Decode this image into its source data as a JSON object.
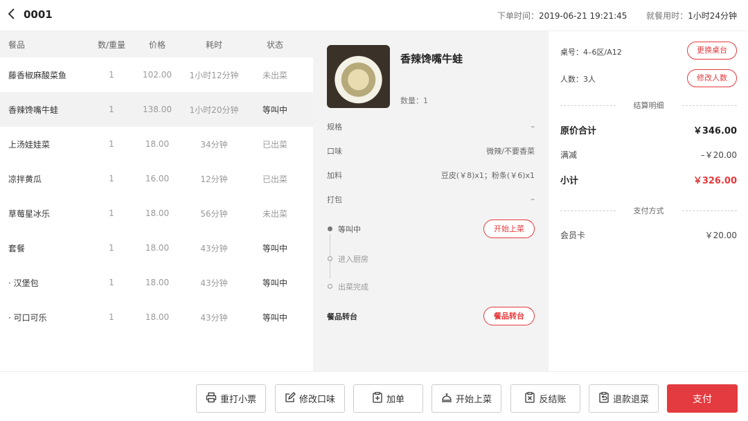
{
  "header": {
    "back_icon": "chevron-left-icon",
    "order_no": "0001",
    "order_time_label": "下单时间：",
    "order_time": "2019-06-21 19:21:45",
    "dining_time_label": "就餐用时：",
    "dining_time": "1小时24分钟"
  },
  "table": {
    "headers": [
      "餐品",
      "数/重量",
      "价格",
      "耗时",
      "状态"
    ],
    "rows": [
      {
        "name": "藤香椒麻酸菜鱼",
        "qty": "1",
        "price": "102.00",
        "time": "1小时12分钟",
        "status": "未出菜"
      },
      {
        "name": "香辣馋嘴牛蛙",
        "qty": "1",
        "price": "138.00",
        "time": "1小时20分钟",
        "status": "等叫中"
      },
      {
        "name": "上汤娃娃菜",
        "qty": "1",
        "price": "18.00",
        "time": "34分钟",
        "status": "已出菜"
      },
      {
        "name": "凉拌黄瓜",
        "qty": "1",
        "price": "16.00",
        "time": "12分钟",
        "status": "已出菜"
      },
      {
        "name": "草莓星冰乐",
        "qty": "1",
        "price": "18.00",
        "time": "56分钟",
        "status": "未出菜"
      },
      {
        "name": "套餐",
        "qty": "1",
        "price": "18.00",
        "time": "43分钟",
        "status": "等叫中"
      },
      {
        "name": "· 汉堡包",
        "qty": "1",
        "price": "18.00",
        "time": "43分钟",
        "status": "等叫中"
      },
      {
        "name": "· 可口可乐",
        "qty": "1",
        "price": "18.00",
        "time": "43分钟",
        "status": "等叫中"
      }
    ]
  },
  "detail": {
    "name": "香辣馋嘴牛蛙",
    "qty": "数量：1",
    "spec_label": "规格",
    "spec_value": "–",
    "taste_label": "口味",
    "taste_value": "微辣/不要香菜",
    "extra_label": "加料",
    "extra_value": "豆皮(￥8)x1；粉条(￥6)x1",
    "pack_label": "打包",
    "pack_value": "–",
    "steps": [
      "等叫中",
      "进入厨房",
      "出菜完成"
    ],
    "start_serve_btn": "开始上菜",
    "transfer_label": "餐品转台",
    "transfer_btn": "餐品转台"
  },
  "summary": {
    "table_no": "桌号：4–6区/A12",
    "change_table_btn": "更换桌台",
    "people": "人数：3人",
    "change_people_btn": "修改人数",
    "settle_title": "结算明细",
    "original_label": "原价合计",
    "original_value": "￥346.00",
    "discount_label": "满减",
    "discount_value": "–￥20.00",
    "subtotal_label": "小计",
    "subtotal_value": "￥326.00",
    "pay_method_title": "支付方式",
    "member_label": "会员卡",
    "member_value": "￥20.00"
  },
  "footer": {
    "reprint": "重打小票",
    "edit_taste": "修改口味",
    "add_order": "加单",
    "start_serve": "开始上菜",
    "reverse_checkout": "反结账",
    "refund": "退款退菜",
    "pay": "支付"
  },
  "colors": {
    "accent": "#e33b3f",
    "panel": "#f3f3f3"
  }
}
